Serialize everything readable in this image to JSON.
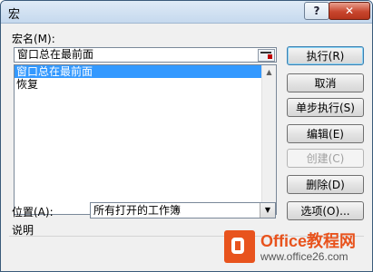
{
  "window": {
    "title": "宏"
  },
  "titlebar": {
    "help_label": "?",
    "close_label": "✕"
  },
  "macro_name": {
    "label": "宏名(M):",
    "value": "窗口总在最前面"
  },
  "macro_list": {
    "items": [
      {
        "label": "窗口总在最前面",
        "selected": true
      },
      {
        "label": "恢复",
        "selected": false
      }
    ]
  },
  "buttons": {
    "run": "执行(R)",
    "cancel": "取消",
    "step_into": "单步执行(S)",
    "edit": "编辑(E)",
    "create": "创建(C)",
    "delete": "删除(D)",
    "options": "选项(O)..."
  },
  "location": {
    "label": "位置(A):",
    "value": "所有打开的工作簿"
  },
  "description": {
    "label": "说明"
  },
  "watermark": {
    "title": "Office教程网",
    "url": "www.office26.com"
  },
  "colors": {
    "selection": "#3399ff",
    "close_button": "#c8462e",
    "watermark": "#e8531d"
  }
}
